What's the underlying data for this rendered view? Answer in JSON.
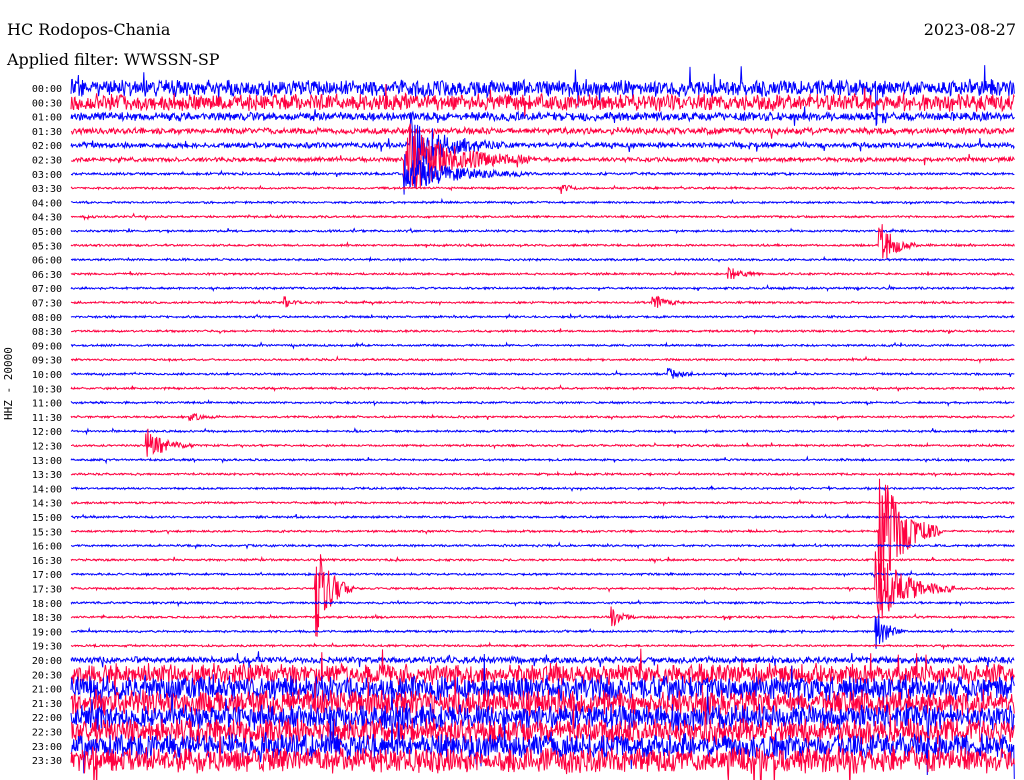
{
  "chart_data": {
    "type": "line",
    "title": "HC Rodopos-Chania",
    "subtitle": "Applied filter: WWSSN-SP",
    "date": "2023-08-27",
    "ylabel": "HHZ - 20000",
    "row_minutes": 30,
    "colors": [
      "#0000ff",
      "#ff0040"
    ],
    "row_labels": [
      "00:00",
      "00:30",
      "01:00",
      "01:30",
      "02:00",
      "02:30",
      "03:00",
      "03:30",
      "04:00",
      "04:30",
      "05:00",
      "05:30",
      "06:00",
      "06:30",
      "07:00",
      "07:30",
      "08:00",
      "08:30",
      "09:00",
      "09:30",
      "10:00",
      "10:30",
      "11:00",
      "11:30",
      "12:00",
      "12:30",
      "13:00",
      "13:30",
      "14:00",
      "14:30",
      "15:00",
      "15:30",
      "16:00",
      "16:30",
      "17:00",
      "17:30",
      "18:00",
      "18:30",
      "19:00",
      "19:30",
      "20:00",
      "20:30",
      "21:00",
      "21:30",
      "22:00",
      "22:30",
      "23:00",
      "23:30"
    ],
    "noise_level": [
      8,
      8,
      4,
      3,
      2.5,
      2,
      1.2,
      1,
      1,
      1,
      1,
      1,
      1,
      1,
      1,
      1,
      1,
      1,
      1,
      1,
      1,
      1,
      1,
      1,
      1,
      1,
      1,
      1,
      1,
      1,
      1,
      1,
      1,
      1,
      1,
      1,
      1,
      1,
      1,
      1,
      3,
      10,
      12,
      12,
      12,
      12,
      12,
      12
    ],
    "events": [
      {
        "row": 4,
        "minute": 10.8,
        "amplitude": 30,
        "duration": 3
      },
      {
        "row": 5,
        "minute": 10.6,
        "amplitude": 40,
        "duration": 4
      },
      {
        "row": 6,
        "minute": 10.6,
        "amplitude": 20,
        "duration": 4
      },
      {
        "row": 7,
        "minute": 15.6,
        "amplitude": 5,
        "duration": 0.6
      },
      {
        "row": 11,
        "minute": 25.7,
        "amplitude": 25,
        "duration": 1.2
      },
      {
        "row": 13,
        "minute": 20.9,
        "amplitude": 8,
        "duration": 1
      },
      {
        "row": 15,
        "minute": 18.5,
        "amplitude": 8,
        "duration": 1
      },
      {
        "row": 15,
        "minute": 6.8,
        "amplitude": 5,
        "duration": 0.6
      },
      {
        "row": 20,
        "minute": 19.0,
        "amplitude": 6,
        "duration": 1.2
      },
      {
        "row": 23,
        "minute": 3.8,
        "amplitude": 4,
        "duration": 1
      },
      {
        "row": 25,
        "minute": 2.4,
        "amplitude": 18,
        "duration": 1.5
      },
      {
        "row": 31,
        "minute": 25.7,
        "amplitude": 70,
        "duration": 2
      },
      {
        "row": 35,
        "minute": 7.8,
        "amplitude": 55,
        "duration": 1.2
      },
      {
        "row": 35,
        "minute": 25.6,
        "amplitude": 40,
        "duration": 2.5
      },
      {
        "row": 37,
        "minute": 17.2,
        "amplitude": 10,
        "duration": 0.8
      },
      {
        "row": 38,
        "minute": 25.6,
        "amplitude": 20,
        "duration": 1
      },
      {
        "row": 0,
        "minute": 25.6,
        "amplitude": 90,
        "duration": 0.05
      }
    ]
  }
}
